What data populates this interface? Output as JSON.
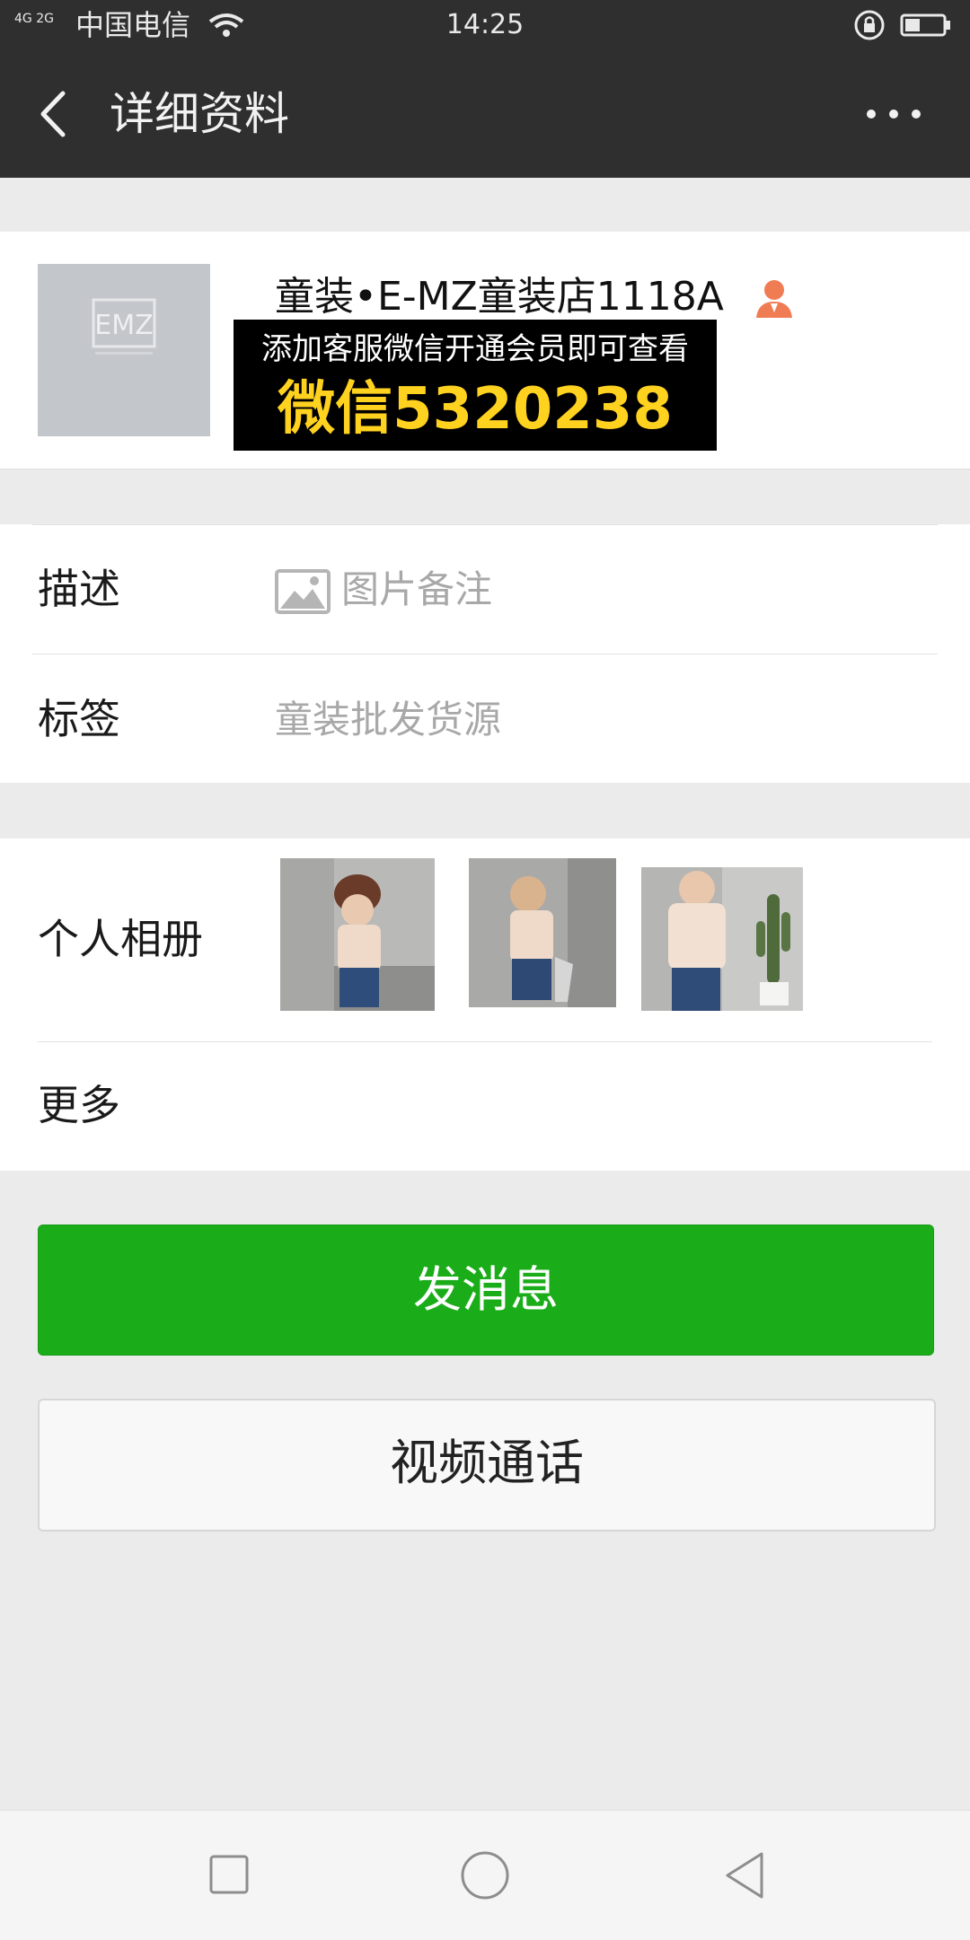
{
  "status_bar": {
    "network": "4G 2G",
    "carrier": "中国电信",
    "time": "14:25"
  },
  "header": {
    "title": "详细资料"
  },
  "profile": {
    "nickname": "童装•E-MZ童装店1118A",
    "avatar_text": "EMZ",
    "promo_line1": "添加客服微信开通会员即可查看",
    "promo_line2": "微信5320238"
  },
  "info": {
    "description_label": "描述",
    "description_value": "图片备注",
    "tags_label": "标签",
    "tags_value": "童装批发货源",
    "album_label": "个人相册",
    "more_label": "更多"
  },
  "actions": {
    "send_message": "发消息",
    "video_call": "视频通话"
  },
  "colors": {
    "title_bar": "#2f2f2f",
    "primary_button": "#1aad19",
    "promo_highlight": "#ffd21f",
    "contact_icon": "#f07c54"
  }
}
